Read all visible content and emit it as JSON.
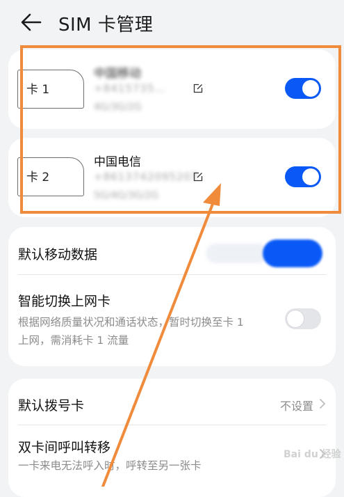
{
  "header": {
    "title": "SIM 卡管理"
  },
  "sims": [
    {
      "chip_label": "卡 1",
      "carrier": "中国移动",
      "number": "+8415735…",
      "network": "4G/3G/2G",
      "enabled": true
    },
    {
      "chip_label": "卡 2",
      "carrier": "中国电信",
      "number": "+8613742095207",
      "network": "5G/4G/3G/2G",
      "enabled": true
    }
  ],
  "data_settings": {
    "default_data_label": "默认移动数据",
    "smart_switch_label": "智能切换上网卡",
    "smart_switch_desc": "根据网络质量状况和通话状态，暂时切换至卡 1 上网，需消耗卡 1 流量",
    "smart_switch_enabled": false
  },
  "call_settings": {
    "default_dial_label": "默认拨号卡",
    "default_dial_value": "不设置",
    "forward_label": "双卡间呼叫转移",
    "forward_desc": "一卡来电无法呼入时，呼转至另一张卡"
  },
  "watermark": "Bai du 经验",
  "colors": {
    "accent": "#0a59f7",
    "annotation": "#f08b3c"
  }
}
